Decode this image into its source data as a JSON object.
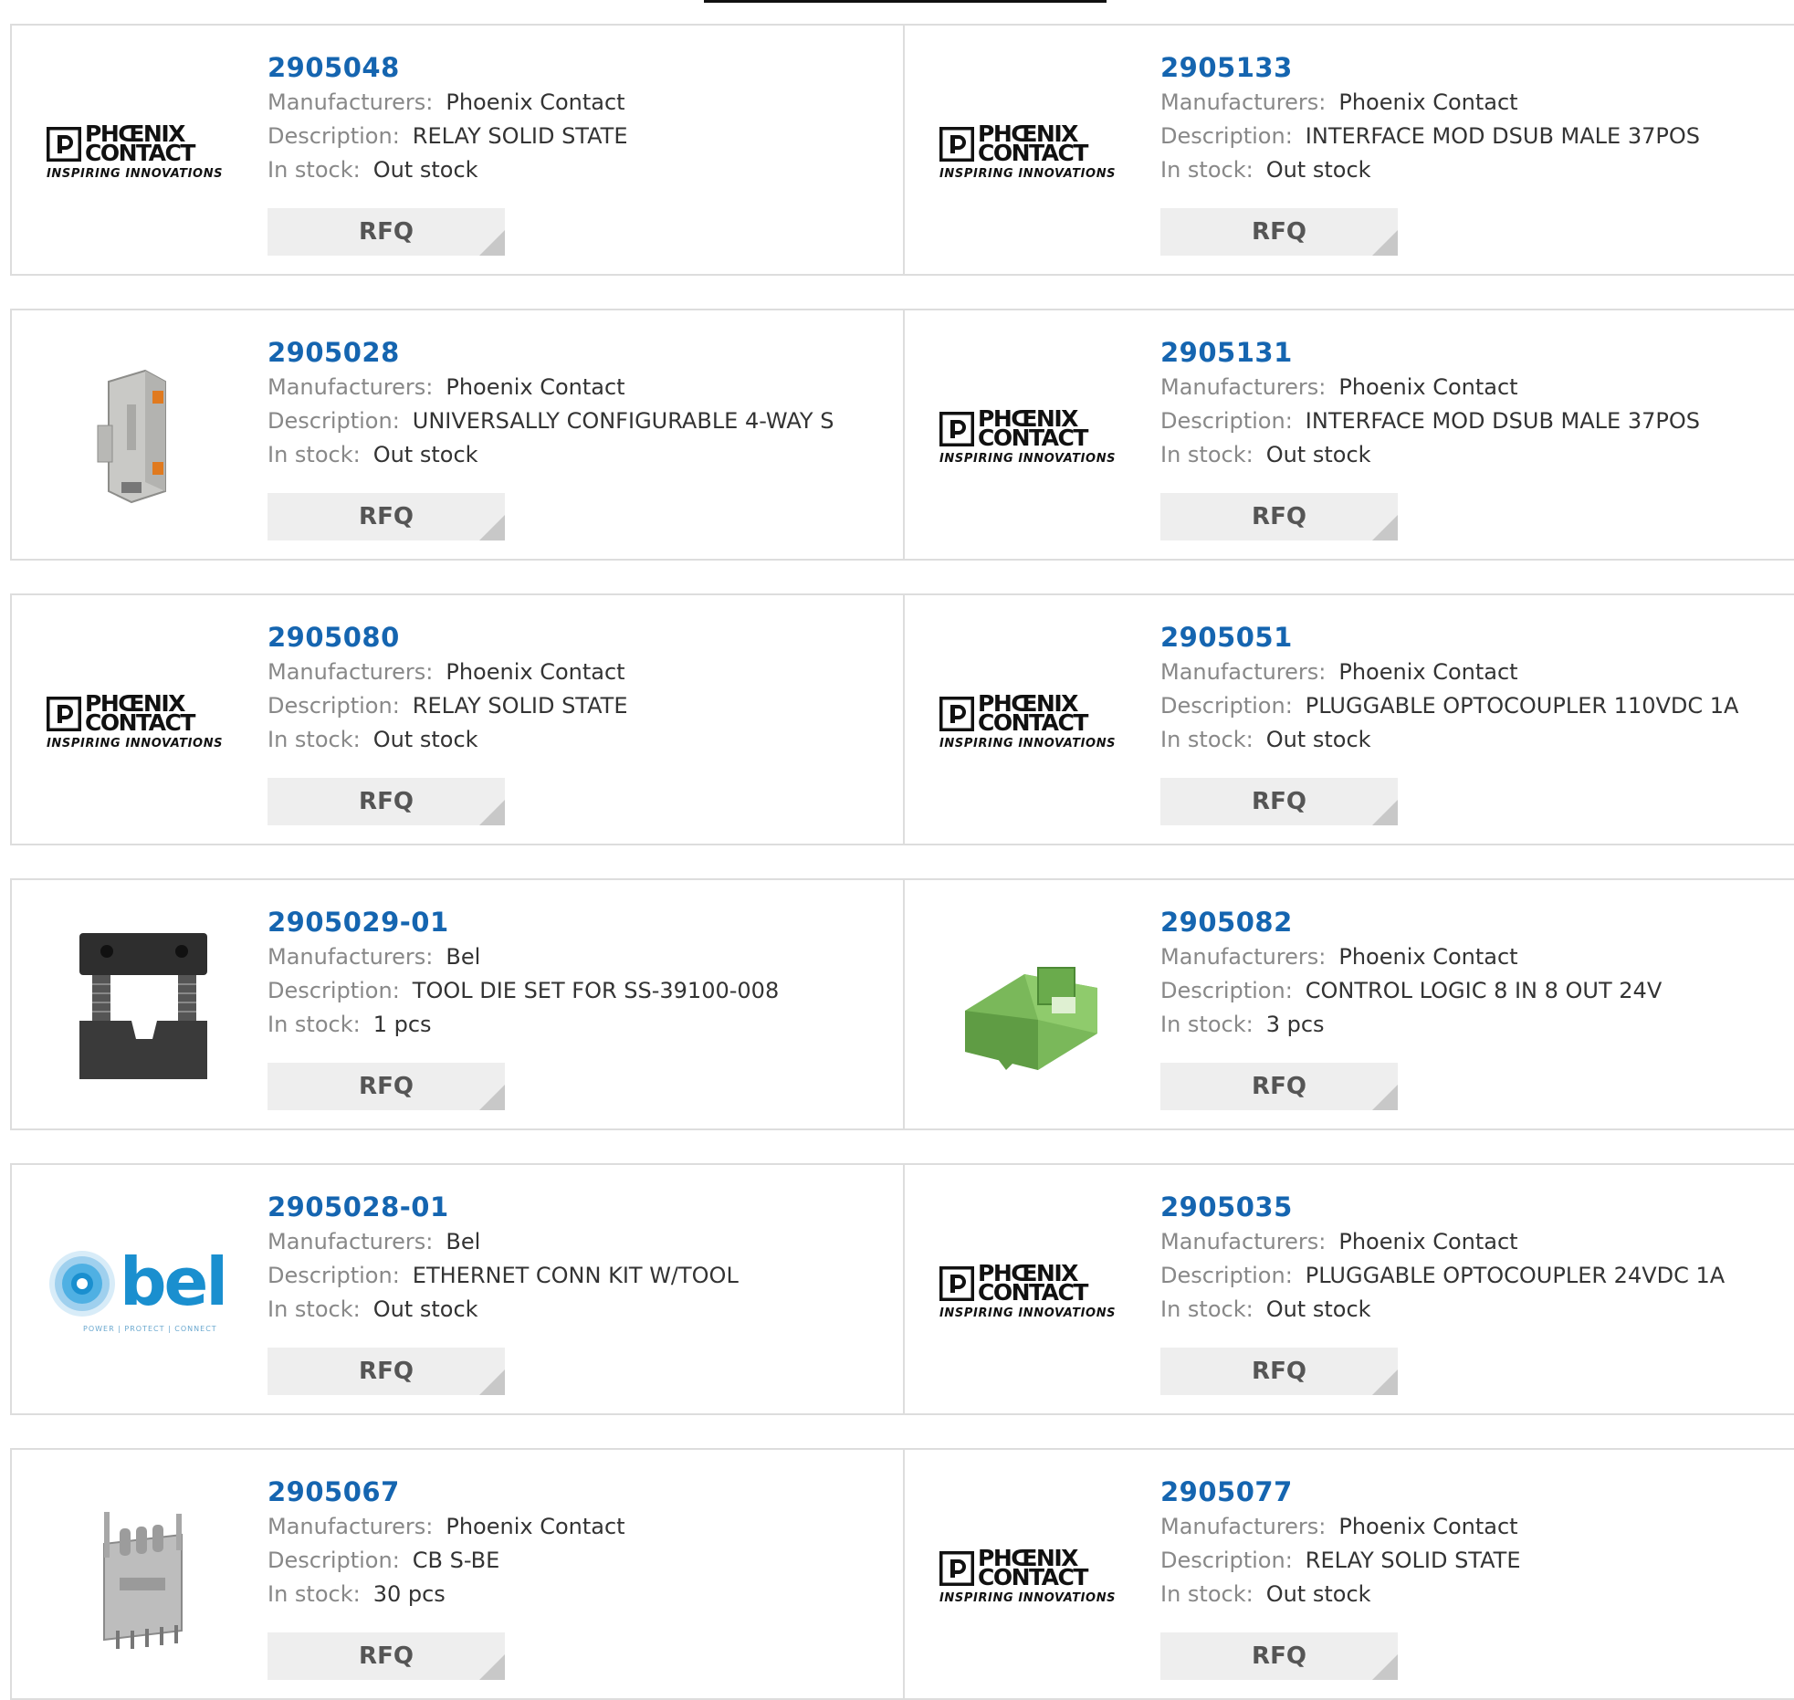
{
  "labels": {
    "manufacturers": "Manufacturers:",
    "description": "Description:",
    "stock": "In stock:",
    "rfq": "RFQ"
  },
  "logos": {
    "phoenix_line1": "PHŒNIX",
    "phoenix_line2": "CONTACT",
    "phoenix_tagline": "INSPIRING INNOVATIONS",
    "bel_word": "bel",
    "bel_tagline": "POWER | PROTECT | CONNECT"
  },
  "colors": {
    "part_link": "#1565b0",
    "label_grey": "#888888",
    "rfq_bg": "#eeeeee",
    "card_border": "#dddddd"
  },
  "products": [
    {
      "part": "2905048",
      "manufacturer": "Phoenix Contact",
      "description": "RELAY SOLID STATE",
      "stock": "Out stock",
      "image": "phoenix-logo"
    },
    {
      "part": "2905133",
      "manufacturer": "Phoenix Contact",
      "description": "INTERFACE MOD DSUB MALE 37POS",
      "stock": "Out stock",
      "image": "phoenix-logo"
    },
    {
      "part": "2905028",
      "manufacturer": "Phoenix Contact",
      "description": "UNIVERSALLY CONFIGURABLE 4-WAY S",
      "stock": "Out stock",
      "image": "din-rail-module-photo"
    },
    {
      "part": "2905131",
      "manufacturer": "Phoenix Contact",
      "description": "INTERFACE MOD DSUB MALE 37POS",
      "stock": "Out stock",
      "image": "phoenix-logo"
    },
    {
      "part": "2905080",
      "manufacturer": "Phoenix Contact",
      "description": "RELAY SOLID STATE",
      "stock": "Out stock",
      "image": "phoenix-logo"
    },
    {
      "part": "2905051",
      "manufacturer": "Phoenix Contact",
      "description": "PLUGGABLE OPTOCOUPLER 110VDC 1A",
      "stock": "Out stock",
      "image": "phoenix-logo"
    },
    {
      "part": "2905029-01",
      "manufacturer": "Bel",
      "description": "TOOL DIE SET FOR SS-39100-008",
      "stock": "1 pcs",
      "image": "tool-die-photo"
    },
    {
      "part": "2905082",
      "manufacturer": "Phoenix Contact",
      "description": "CONTROL LOGIC 8 IN 8 OUT 24V",
      "stock": "3 pcs",
      "image": "green-connector-photo"
    },
    {
      "part": "2905028-01",
      "manufacturer": "Bel",
      "description": "ETHERNET CONN KIT W/TOOL",
      "stock": "Out stock",
      "image": "bel-logo"
    },
    {
      "part": "2905035",
      "manufacturer": "Phoenix Contact",
      "description": "PLUGGABLE OPTOCOUPLER 24VDC 1A",
      "stock": "Out stock",
      "image": "phoenix-logo"
    },
    {
      "part": "2905067",
      "manufacturer": "Phoenix Contact",
      "description": "CB S-BE",
      "stock": "30 pcs",
      "image": "terminal-block-photo"
    },
    {
      "part": "2905077",
      "manufacturer": "Phoenix Contact",
      "description": "RELAY SOLID STATE",
      "stock": "Out stock",
      "image": "phoenix-logo"
    }
  ]
}
